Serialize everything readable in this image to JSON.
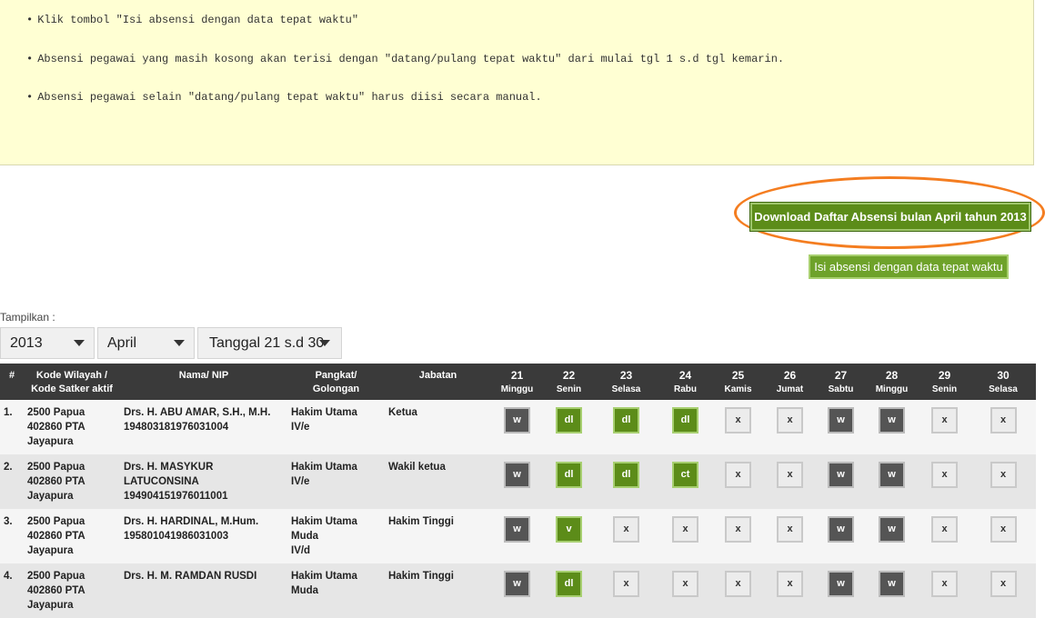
{
  "notice": {
    "bullet": "•",
    "lines": [
      "Klik tombol \"Isi absensi dengan data tepat waktu\"",
      "Absensi pegawai yang masih kosong akan terisi dengan \"datang/pulang tepat waktu\" dari mulai tgl 1 s.d tgl kemarin.",
      "Absensi pegawai selain \"datang/pulang tepat waktu\" harus diisi secara manual."
    ]
  },
  "buttons": {
    "download": "Download Daftar Absensi bulan April tahun 2013",
    "isi": "Isi absensi dengan data tepat waktu"
  },
  "filters": {
    "label": "Tampilkan :",
    "year": "2013",
    "month": "April",
    "range": "Tanggal 21 s.d 30"
  },
  "table": {
    "headers": {
      "no": "#",
      "kode": [
        "Kode Wilayah /",
        "Kode Satker aktif"
      ],
      "nama": "Nama/ NIP",
      "pangkat": [
        "Pangkat/",
        "Golongan"
      ],
      "jabatan": "Jabatan"
    },
    "days": [
      {
        "num": "21",
        "name": "Minggu"
      },
      {
        "num": "22",
        "name": "Senin"
      },
      {
        "num": "23",
        "name": "Selasa"
      },
      {
        "num": "24",
        "name": "Rabu"
      },
      {
        "num": "25",
        "name": "Kamis"
      },
      {
        "num": "26",
        "name": "Jumat"
      },
      {
        "num": "27",
        "name": "Sabtu"
      },
      {
        "num": "28",
        "name": "Minggu"
      },
      {
        "num": "29",
        "name": "Senin"
      },
      {
        "num": "30",
        "name": "Selasa"
      }
    ],
    "rows": [
      {
        "no": "1.",
        "kode": [
          "2500 Papua",
          "402860 PTA",
          "Jayapura"
        ],
        "nama": [
          "Drs. H. ABU AMAR, S.H., M.H.",
          "194803181976031004"
        ],
        "pangkat": [
          "Hakim Utama",
          "IV/e"
        ],
        "jabatan": "Ketua",
        "codes": [
          "w",
          "dl",
          "dl",
          "dl",
          "x",
          "x",
          "w",
          "w",
          "x",
          "x"
        ]
      },
      {
        "no": "2.",
        "kode": [
          "2500 Papua",
          "402860 PTA",
          "Jayapura"
        ],
        "nama": [
          "Drs. H. MASYKUR",
          "LATUCONSINA",
          "194904151976011001"
        ],
        "pangkat": [
          "Hakim Utama",
          "IV/e"
        ],
        "jabatan": "Wakil ketua",
        "codes": [
          "w",
          "dl",
          "dl",
          "ct",
          "x",
          "x",
          "w",
          "w",
          "x",
          "x"
        ]
      },
      {
        "no": "3.",
        "kode": [
          "2500 Papua",
          "402860 PTA",
          "Jayapura"
        ],
        "nama": [
          "Drs. H. HARDINAL, M.Hum.",
          "195801041986031003"
        ],
        "pangkat": [
          "Hakim Utama",
          "Muda",
          "IV/d"
        ],
        "jabatan": "Hakim Tinggi",
        "codes": [
          "w",
          "v",
          "x",
          "x",
          "x",
          "x",
          "w",
          "w",
          "x",
          "x"
        ]
      },
      {
        "no": "4.",
        "kode": [
          "2500 Papua",
          "402860 PTA",
          "Jayapura"
        ],
        "nama": [
          "Drs. H. M. RAMDAN RUSDI",
          ""
        ],
        "pangkat": [
          "Hakim Utama",
          "Muda"
        ],
        "jabatan": "Hakim Tinggi",
        "codes": [
          "w",
          "dl",
          "x",
          "x",
          "x",
          "x",
          "w",
          "w",
          "x",
          "x"
        ]
      }
    ]
  }
}
